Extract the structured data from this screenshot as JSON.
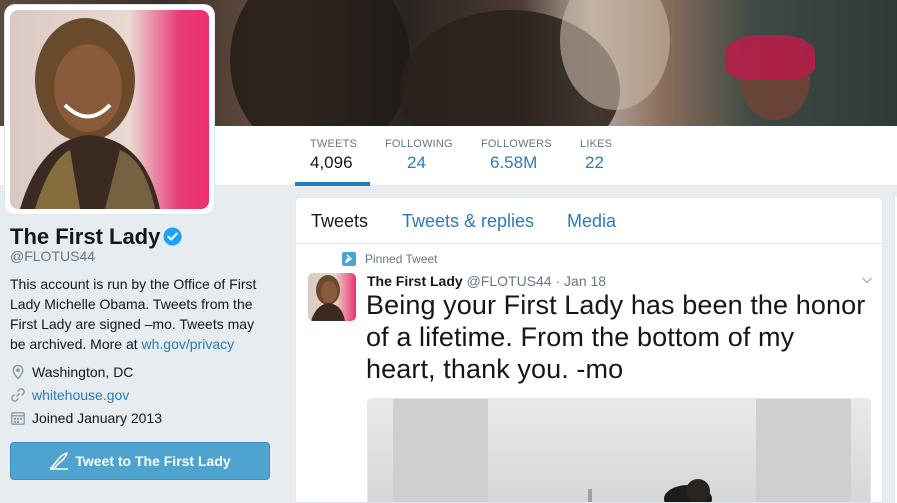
{
  "profile": {
    "name": "The First Lady",
    "handle": "@FLOTUS44",
    "bio_text": "This account is run by the Office of First Lady Michelle Obama. Tweets from the First Lady are signed –mo. Tweets may be archived. More at ",
    "bio_link": "wh.gov/privacy",
    "location": "Washington, DC",
    "website": "whitehouse.gov",
    "joined": "Joined January 2013",
    "tweet_to_label": "Tweet to The First Lady"
  },
  "stats": [
    {
      "label": "TWEETS",
      "value": "4,096"
    },
    {
      "label": "FOLLOWING",
      "value": "24"
    },
    {
      "label": "FOLLOWERS",
      "value": "6.58M"
    },
    {
      "label": "LIKES",
      "value": "22"
    }
  ],
  "tabs": [
    {
      "label": "Tweets"
    },
    {
      "label": "Tweets & replies"
    },
    {
      "label": "Media"
    }
  ],
  "tweet": {
    "pinned_label": "Pinned Tweet",
    "author_name": "The First Lady",
    "author_meta": "@FLOTUS44 · Jan 18",
    "text": "Being your First Lady has been the honor of a lifetime. From the bottom of my heart, thank you. -mo"
  },
  "colors": {
    "link": "#2b7bb9",
    "button": "#4ea3cf",
    "verified": "#1da1f2"
  },
  "icons": [
    "verified-badge-icon",
    "location-pin-icon",
    "link-icon",
    "calendar-icon",
    "quill-icon",
    "pin-icon",
    "chevron-down-icon"
  ]
}
